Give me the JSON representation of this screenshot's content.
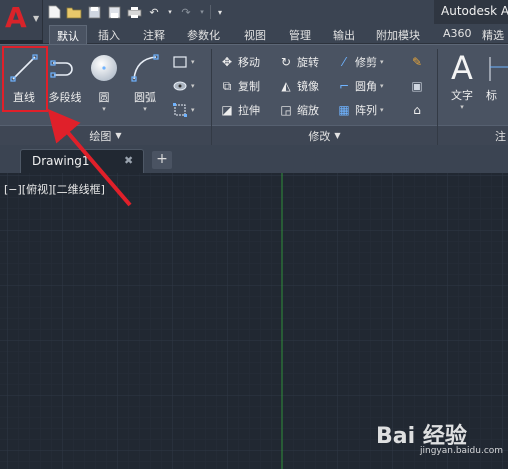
{
  "app": {
    "title": "Autodesk A",
    "logo_letter": "A"
  },
  "ribbon_tabs": [
    "默认",
    "插入",
    "注释",
    "参数化",
    "视图",
    "管理",
    "输出",
    "附加模块",
    "A360",
    "精选"
  ],
  "draw_panel": {
    "tools": {
      "line": "直线",
      "polyline": "多段线",
      "circle": "圆",
      "arc": "圆弧"
    },
    "footer": "绘图"
  },
  "modify_panel": {
    "move": "移动",
    "rotate": "旋转",
    "trim": "修剪",
    "copy": "复制",
    "mirror": "镜像",
    "fillet": "圆角",
    "stretch": "拉伸",
    "scale": "缩放",
    "array": "阵列",
    "footer": "修改"
  },
  "annotation_panel": {
    "text": "文字",
    "dimension": "标",
    "footer": "注"
  },
  "document": {
    "tab_name": "Drawing1"
  },
  "viewport": {
    "label": "[−][俯视][二维线框]"
  },
  "watermark": {
    "text": "Bai 经验",
    "sub": "jingyan.baidu.com"
  },
  "colors": {
    "accent_red": "#e0202a",
    "canvas_bg": "#212832",
    "ribbon_bg": "#4a5362",
    "grid": "#2e3744",
    "y_axis": "#2f8f3a"
  }
}
